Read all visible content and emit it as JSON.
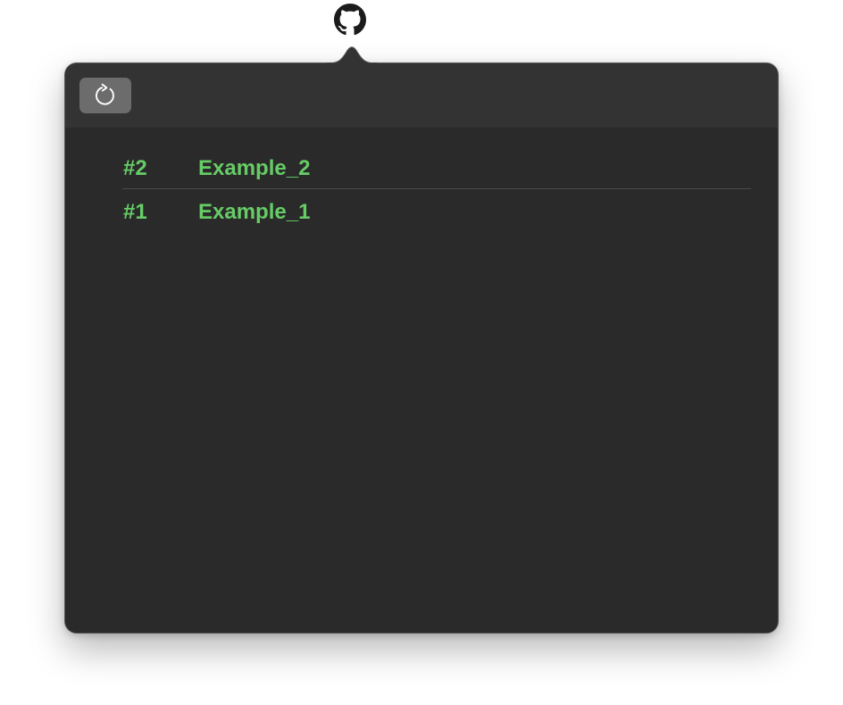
{
  "status_item": {
    "icon": "github-icon"
  },
  "toolbar": {
    "refresh_icon": "refresh-icon"
  },
  "accent_color": "#66cc66",
  "issues": [
    {
      "number": "#2",
      "title": "Example_2"
    },
    {
      "number": "#1",
      "title": "Example_1"
    }
  ]
}
